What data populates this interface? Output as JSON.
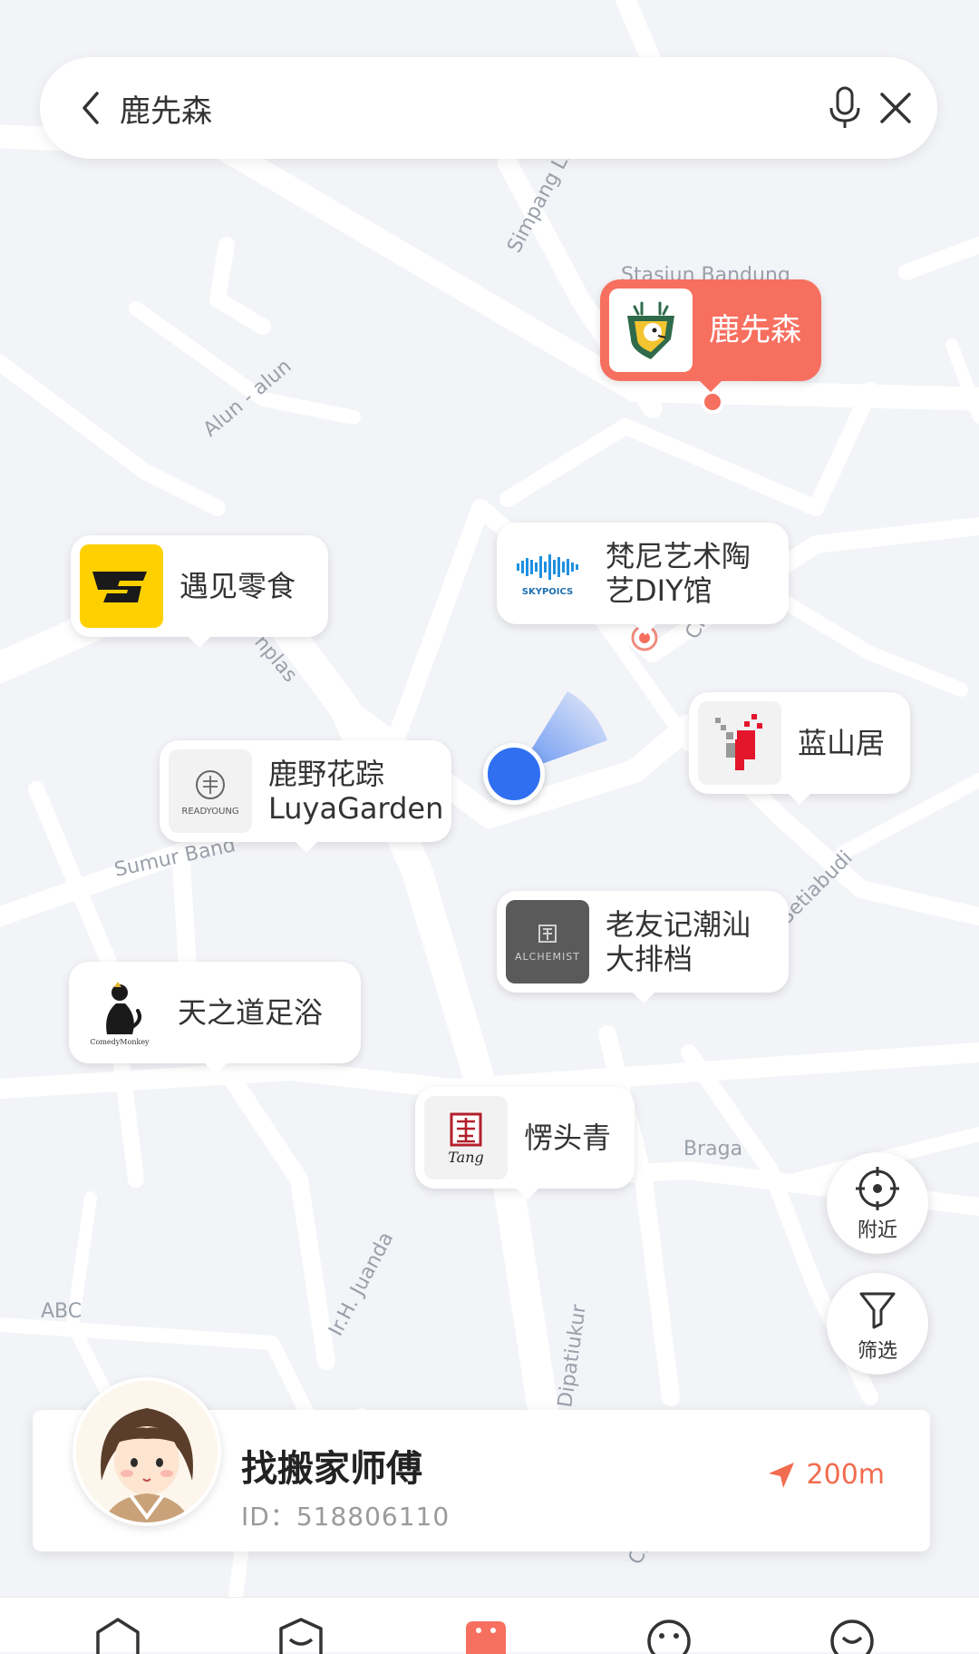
{
  "search": {
    "query": "鹿先森"
  },
  "map_labels": {
    "street_simpang": "Simpang Li",
    "stasiun": "Stasiun Bandung",
    "alun": "Alun - alun",
    "banceuy": "nplas",
    "sumur": "Sumur Band",
    "setiabudi": "Setiabudi",
    "braga": "Braga",
    "abc": "ABC",
    "juanda": "Ir.H. Juanda",
    "dipatiukur": "Dipatiukur",
    "ci_top": "Ci",
    "ci_bottom": "Ci"
  },
  "places": [
    {
      "name": "鹿先森",
      "featured": true,
      "logo_icon": "deer-shield-logo"
    },
    {
      "name": "遇见零食",
      "featured": false,
      "logo_icon": "snack-logo"
    },
    {
      "name": "梵尼艺术陶\n艺DIY馆",
      "featured": false,
      "logo_icon": "skypoics-logo",
      "logo_text": "SKYPOICS"
    },
    {
      "name": "蓝山居",
      "featured": false,
      "logo_icon": "pixel-deer-logo"
    },
    {
      "name": "鹿野花踪\nLuyaGarden",
      "featured": false,
      "logo_icon": "readyoung-logo",
      "logo_text": "READYOUNG"
    },
    {
      "name": "老友记潮汕\n大排档",
      "featured": false,
      "logo_icon": "alchemist-logo",
      "logo_text": "ALCHEMIST"
    },
    {
      "name": "天之道足浴",
      "featured": false,
      "logo_icon": "monkey-logo",
      "logo_text": "ComedyMonkey"
    },
    {
      "name": "愣头青",
      "featured": false,
      "logo_icon": "tang-seal-logo",
      "logo_text": "Tang"
    }
  ],
  "controls": {
    "nearby_label": "附近",
    "filter_label": "筛选"
  },
  "user_card": {
    "name": "找搬家师傅",
    "id_text": "ID：518806110",
    "distance": "200m"
  },
  "colors": {
    "accent": "#f76f5f",
    "user_dot": "#2f6ff0",
    "distance": "#f26c4f"
  }
}
